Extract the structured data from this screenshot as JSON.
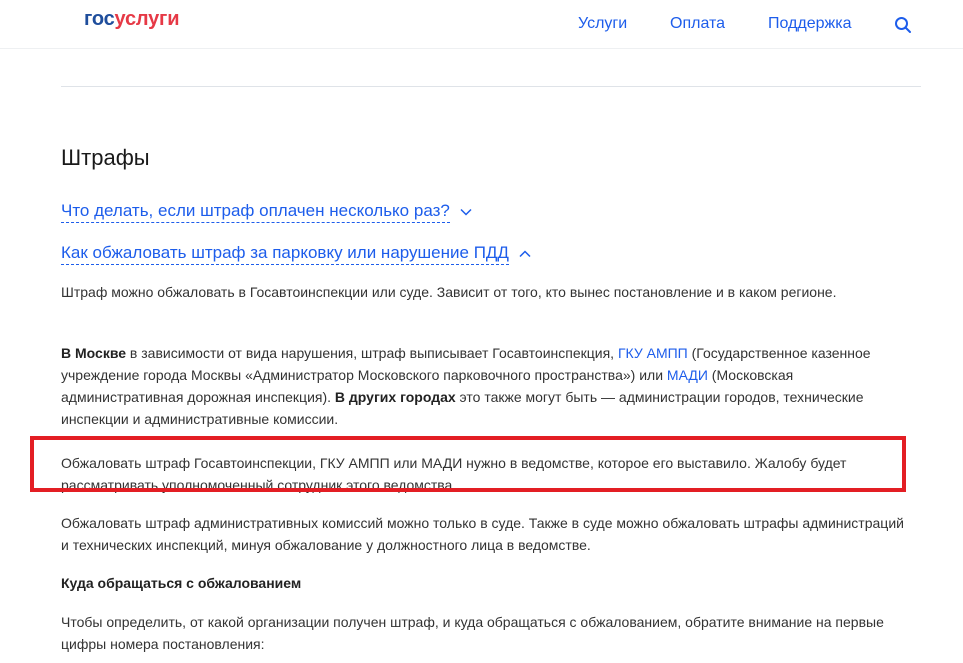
{
  "header": {
    "logo_part1": "гос",
    "logo_part2": "услуги",
    "nav": {
      "services": "Услуги",
      "payment": "Оплата",
      "support": "Поддержка"
    },
    "search_icon": "search-icon"
  },
  "page": {
    "title": "Штрафы"
  },
  "faq": [
    {
      "question": "Что делать, если штраф оплачен несколько раз?",
      "state": "collapsed",
      "icon": "chevron-down-icon"
    },
    {
      "question": "Как обжаловать штраф за парковку или нарушение ПДД",
      "state": "expanded",
      "icon": "chevron-up-icon"
    }
  ],
  "answer": {
    "p1": "Штраф можно обжаловать в Госавтоинспекции или суде. Зависит от того, кто вынес постановление и в каком регионе.",
    "p2": {
      "bold1": "В Москве",
      "t1": " в зависимости от вида нарушения, штраф выписывает Госавтоинспекция, ",
      "link1": "ГКУ АМПП",
      "t2": " (Государственное казенное учреждение города Москвы «Администратор Московского парковочного пространства») или ",
      "link2": "МАДИ",
      "t3": " (Московская административная дорожная инспекция). ",
      "bold2": "В других городах",
      "t4": " это также могут быть — администрации городов, технические инспекции и административные комиссии."
    },
    "p3": "Обжаловать штраф Госавтоинспекции, ГКУ АМПП или МАДИ нужно в ведомстве, которое его выставило. Жалобу будет рассматривать уполномоченный сотрудник этого ведомства.",
    "p4": "Обжаловать штраф административных комиссий можно только в суде. Также в суде можно обжаловать штрафы администраций и технических инспекций, минуя обжалование у должностного лица в ведомстве.",
    "subheading": "Куда обращаться с обжалованием",
    "p6": "Чтобы определить, от какой организации получен штраф, и куда обращаться с обжалованием, обратите внимание на первые цифры номера постановления:"
  },
  "colors": {
    "link": "#1d5deb",
    "logo_blue": "#1f4e9c",
    "logo_red": "#e63946",
    "highlight": "#e31e24"
  }
}
